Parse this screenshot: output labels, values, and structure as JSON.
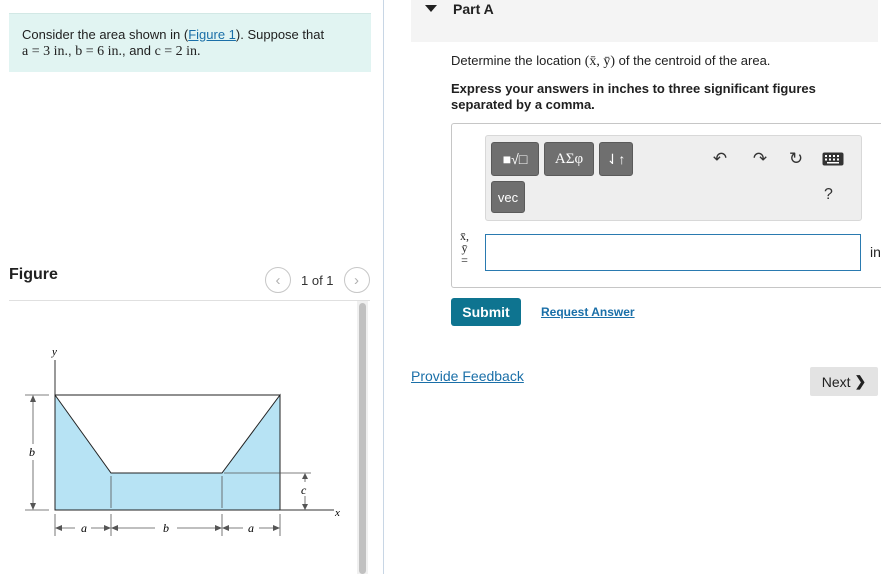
{
  "problem": {
    "intro": "Consider the area shown in (",
    "figure_link": "Figure 1",
    "mid": "). Suppose that",
    "a_val": "a = 3 in.",
    "b_val": "b = 6 in.",
    "c_val": "c = 2 in."
  },
  "figure": {
    "title": "Figure",
    "counter": "1 of 1",
    "labels": {
      "y": "y",
      "x": "x",
      "b_left": "b",
      "c": "c",
      "a1": "a",
      "b_bottom": "b",
      "a2": "a"
    }
  },
  "part": {
    "title": "Part A",
    "instruction_prefix": "Determine the location",
    "coords": "(x̄, ȳ)",
    "instruction_suffix": "of the centroid of the area.",
    "instruction_bold": "Express your answers in inches to three significant figures separated by a comma."
  },
  "toolbar": {
    "template_btn": "■√□",
    "greek_btn": "ΑΣφ",
    "arrows_btn": "⇃↑",
    "vec_btn": "vec",
    "help": "?"
  },
  "answer": {
    "lhs_line1": "x̄,",
    "lhs_line2": "ȳ",
    "lhs_line3": "=",
    "value": "",
    "units": "in"
  },
  "actions": {
    "submit": "Submit",
    "request": "Request Answer",
    "feedback": "Provide Feedback",
    "next": "Next"
  },
  "colors": {
    "problem_bg": "#e1f4f2",
    "link": "#1a6fa8",
    "submit_bg": "#0e7490",
    "shape_fill": "#b7e3f4"
  }
}
